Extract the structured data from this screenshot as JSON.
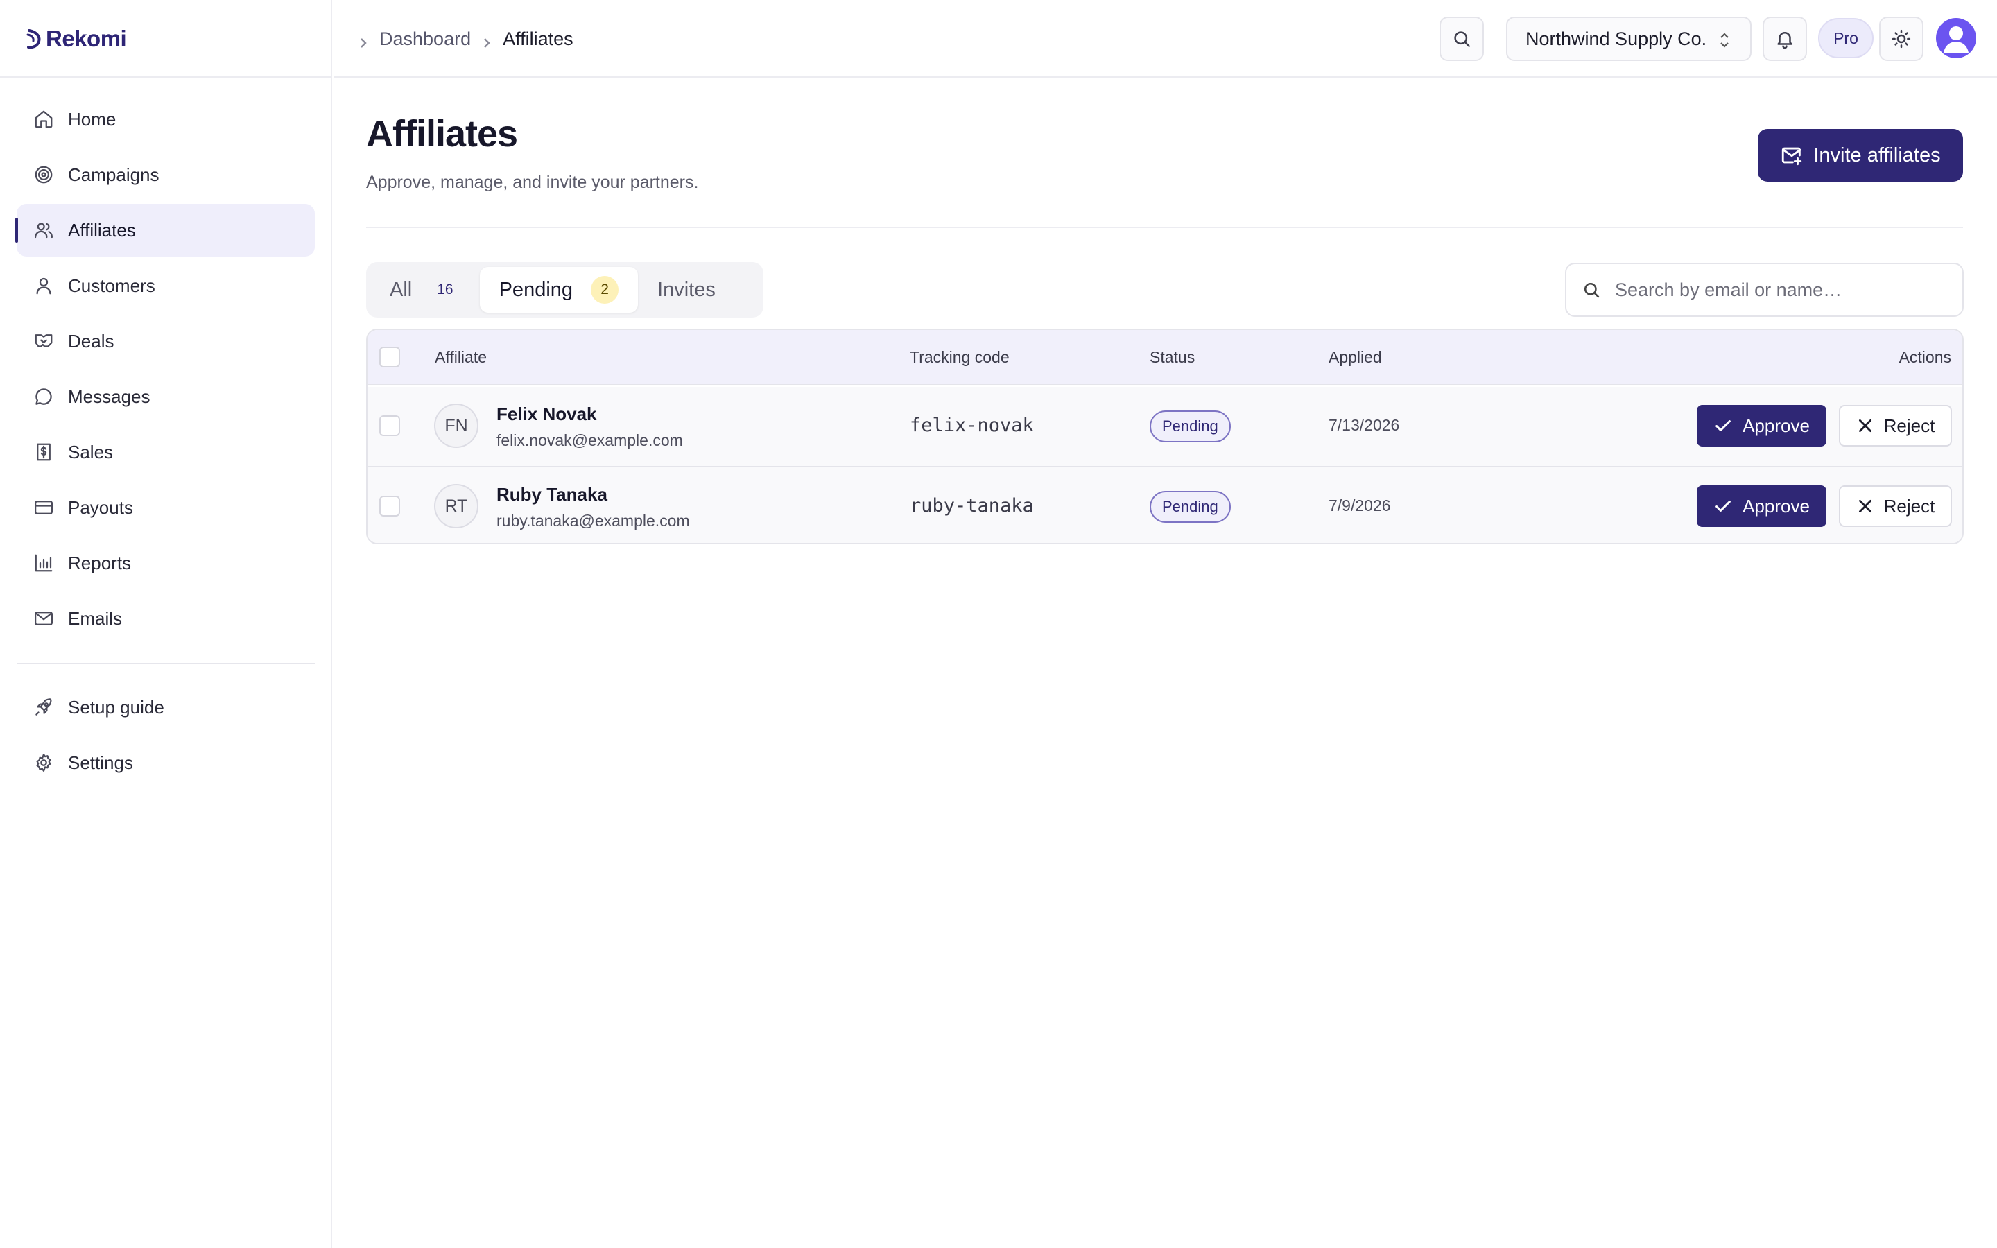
{
  "app": {
    "name": "Rekomi"
  },
  "sidebar": {
    "items": [
      {
        "label": "Home",
        "icon": "home-icon"
      },
      {
        "label": "Campaigns",
        "icon": "target-icon"
      },
      {
        "label": "Affiliates",
        "icon": "users-icon",
        "active": true
      },
      {
        "label": "Customers",
        "icon": "user-icon"
      },
      {
        "label": "Deals",
        "icon": "handshake-icon"
      },
      {
        "label": "Messages",
        "icon": "chat-bubble-icon"
      },
      {
        "label": "Sales",
        "icon": "receipt-dollar-icon"
      },
      {
        "label": "Payouts",
        "icon": "credit-card-icon"
      },
      {
        "label": "Reports",
        "icon": "bar-chart-icon"
      },
      {
        "label": "Emails",
        "icon": "mail-icon"
      }
    ],
    "secondary": [
      {
        "label": "Setup guide",
        "icon": "rocket-icon"
      },
      {
        "label": "Settings",
        "icon": "gear-icon"
      }
    ]
  },
  "topbar": {
    "breadcrumb": [
      "Dashboard",
      "Affiliates"
    ],
    "org_name": "Northwind Supply Co.",
    "plan_badge": "Pro"
  },
  "page": {
    "title": "Affiliates",
    "subtitle": "Approve, manage, and invite your partners.",
    "invite_button": "Invite affiliates"
  },
  "tabs": [
    {
      "label": "All",
      "count": "16"
    },
    {
      "label": "Pending",
      "count": "2",
      "active": true
    },
    {
      "label": "Invites"
    }
  ],
  "search": {
    "placeholder": "Search by email or name…"
  },
  "table": {
    "columns": [
      "Affiliate",
      "Tracking code",
      "Status",
      "Applied",
      "Actions"
    ],
    "rows": [
      {
        "initials": "FN",
        "name": "Felix Novak",
        "email": "felix.novak@example.com",
        "code": "felix-novak",
        "status": "Pending",
        "applied": "7/13/2026"
      },
      {
        "initials": "RT",
        "name": "Ruby Tanaka",
        "email": "ruby.tanaka@example.com",
        "code": "ruby-tanaka",
        "status": "Pending",
        "applied": "7/9/2026"
      }
    ],
    "approve_label": "Approve",
    "reject_label": "Reject"
  },
  "colors": {
    "brand": "#2f2775",
    "active_nav_bg": "#efeefb",
    "pending_badge_bg": "#fdf1b8",
    "avatar": "#6b54f0"
  }
}
